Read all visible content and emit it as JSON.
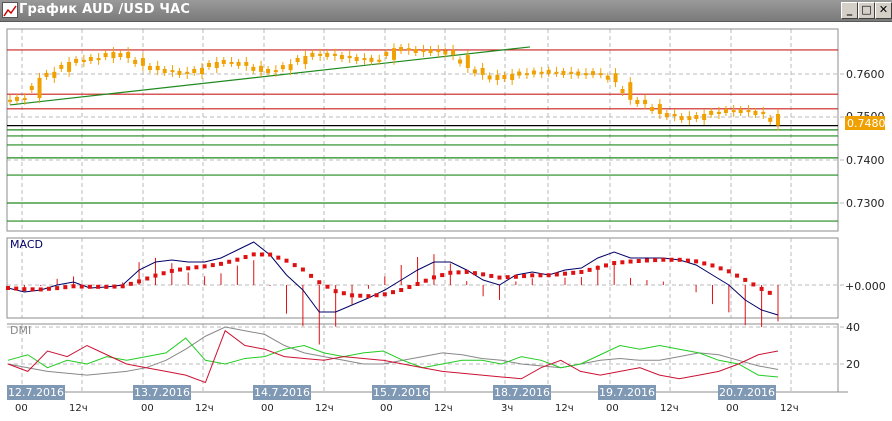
{
  "window": {
    "title": "График AUD /USD  ЧАС",
    "minimize": "_",
    "maximize": "□",
    "close": "✕"
  },
  "colors": {
    "candle": "#f0a000",
    "resistance": "#cc2020",
    "support": "#1f8a1f",
    "current": "#000000",
    "macd": "#000066",
    "signal": "#dd1111",
    "adx": "#888888",
    "plus_di": "#22cc22",
    "minus_di": "#cc1133",
    "date_box": "#7f98b3"
  },
  "price_panel": {
    "axis_labels": [
      "0.7600",
      "0.7500",
      "0.7400",
      "0.7300"
    ],
    "axis_values": [
      0.76,
      0.75,
      0.74,
      0.73
    ],
    "current_price": "0.7480",
    "current_value": 0.748,
    "closes": [
      0.754,
      0.7544,
      0.7591,
      0.7605,
      0.7628,
      0.7633,
      0.7637,
      0.7651,
      0.7637,
      0.7619,
      0.7609,
      0.7605,
      0.76,
      0.7614,
      0.7628,
      0.7628,
      0.7619,
      0.7605,
      0.7609,
      0.7623,
      0.7642,
      0.7647,
      0.7642,
      0.7637,
      0.7633,
      0.7633,
      0.766,
      0.7656,
      0.7651,
      0.7656,
      0.7644,
      0.7614,
      0.7598,
      0.7586,
      0.76,
      0.7602,
      0.7605,
      0.7605,
      0.76,
      0.7602,
      0.7602,
      0.7581,
      0.754,
      0.753,
      0.7507,
      0.7502,
      0.7493,
      0.7507,
      0.7512,
      0.7516,
      0.7512,
      0.7507,
      0.748
    ],
    "resistance_levels": [
      0.7656,
      0.7553,
      0.7519
    ],
    "support_levels": [
      0.747,
      0.7456,
      0.7435,
      0.7405,
      0.7365,
      0.73,
      0.7258
    ],
    "trendline": [
      0.7528,
      0.7663
    ]
  },
  "macd_panel": {
    "label": "MACD",
    "zero_label": "+0.000",
    "macd_x1e4": [
      -0.15,
      -0.35,
      -0.25,
      0,
      0.15,
      -0.15,
      -0.1,
      0,
      0.75,
      1.15,
      1.25,
      1.15,
      1.15,
      1.35,
      1.75,
      2.15,
      1.5,
      0.5,
      -0.25,
      -1.35,
      -1.35,
      -1,
      -0.65,
      -0.25,
      0.25,
      0.75,
      1.15,
      1.15,
      0.75,
      0.25,
      0,
      0.5,
      0.65,
      0.5,
      0.75,
      0.85,
      1.35,
      1.65,
      1.35,
      1.35,
      1.35,
      1.25,
      1,
      0.5,
      0,
      -0.75,
      -1.25,
      -1.5
    ]
  },
  "dmi_panel": {
    "label": "DMI",
    "axis_labels": [
      "40",
      "20"
    ],
    "axis_values": [
      40,
      20
    ],
    "adx": [
      20,
      18,
      16,
      15,
      14,
      15,
      16,
      18,
      22,
      28,
      35,
      40,
      38,
      36,
      30,
      26,
      24,
      22,
      20,
      20,
      22,
      24,
      26,
      25,
      23,
      22,
      20,
      19,
      18,
      20,
      22,
      23,
      22,
      22,
      24,
      26,
      25,
      22,
      19,
      17
    ],
    "plus_di": [
      22,
      25,
      18,
      22,
      20,
      24,
      22,
      24,
      26,
      34,
      22,
      20,
      23,
      24,
      28,
      30,
      26,
      24,
      26,
      27,
      22,
      18,
      20,
      22,
      22,
      20,
      24,
      22,
      18,
      20,
      25,
      30,
      28,
      30,
      28,
      26,
      22,
      20,
      14,
      13
    ],
    "minus_di": [
      20,
      16,
      27,
      24,
      30,
      25,
      20,
      18,
      16,
      14,
      10,
      38,
      30,
      28,
      24,
      23,
      22,
      24,
      23,
      22,
      20,
      18,
      16,
      15,
      14,
      13,
      12,
      18,
      22,
      16,
      14,
      16,
      18,
      14,
      12,
      14,
      16,
      20,
      25,
      27
    ]
  },
  "time_axis": {
    "dates": [
      "12.7.2016",
      "13.7.2016",
      "14.7.2016",
      "15.7.2016",
      "18.7.2016",
      "19.7.2016",
      "20.7.2016"
    ],
    "hours": [
      [
        "00",
        "12ч"
      ],
      [
        "00",
        "12ч"
      ],
      [
        "00",
        "12ч"
      ],
      [
        "00",
        "12ч"
      ],
      [
        "3ч",
        "12ч"
      ],
      [
        "00",
        "12ч"
      ],
      [
        "00",
        "12ч"
      ]
    ]
  }
}
